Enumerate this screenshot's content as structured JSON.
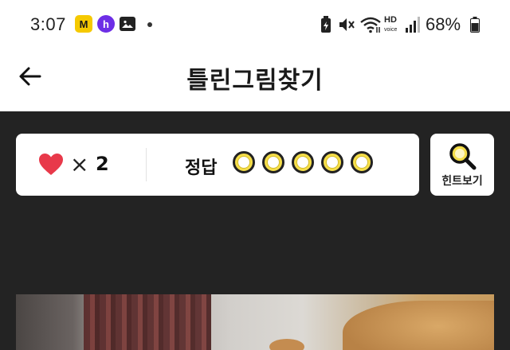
{
  "status_bar": {
    "time": "3:07",
    "battery": "68%",
    "icons": [
      "m-app-icon",
      "h-app-icon",
      "photo-icon",
      "notification-dot",
      "battery-saver-icon",
      "mute-icon",
      "wifi-icon",
      "hd-voice-icon",
      "signal-icon",
      "battery-icon"
    ]
  },
  "header": {
    "title": "틀린그림찾기",
    "back_icon": "arrow-left-icon"
  },
  "game_info": {
    "lives_symbol": "×",
    "lives": "2",
    "answer_label": "정답",
    "answers_total": 5,
    "answers_found": 0
  },
  "hint": {
    "label": "힌트보기",
    "icon": "magnifier-icon"
  },
  "colors": {
    "accent_yellow": "#f5de4a",
    "heart": "#e8394a",
    "background": "#232323"
  }
}
